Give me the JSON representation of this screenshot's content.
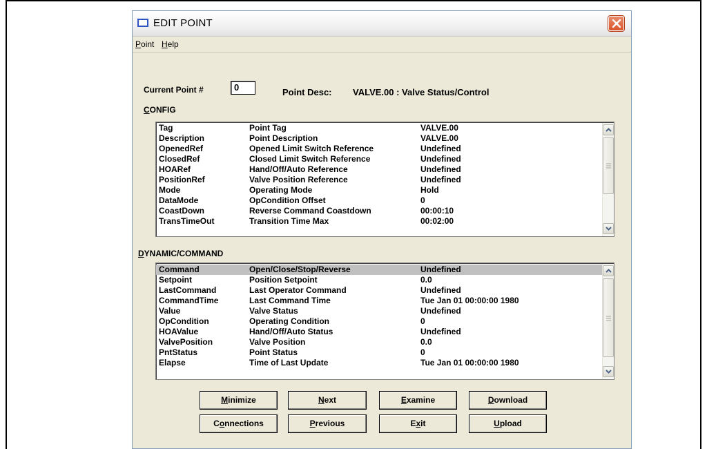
{
  "window": {
    "title": "EDIT POINT",
    "close_glyph": "×"
  },
  "menu": {
    "items": [
      {
        "mnemonic": "P",
        "rest": "oint"
      },
      {
        "mnemonic": "H",
        "rest": "elp"
      }
    ]
  },
  "current_point": {
    "label": "Current Point #",
    "value": "0"
  },
  "point_desc": {
    "label": "Point Desc:",
    "value": "VALVE.00 : Valve Status/Control"
  },
  "config": {
    "label_mnemonic": "C",
    "label_rest": "ONFIG",
    "rows": [
      {
        "name": "Tag",
        "desc": "Point Tag",
        "value": "VALVE.00"
      },
      {
        "name": "Description",
        "desc": "Point Description",
        "value": "VALVE.00"
      },
      {
        "name": "OpenedRef",
        "desc": "Opened Limit Switch Reference",
        "value": "Undefined"
      },
      {
        "name": "ClosedRef",
        "desc": "Closed Limit Switch Reference",
        "value": "Undefined"
      },
      {
        "name": "HOARef",
        "desc": "Hand/Off/Auto Reference",
        "value": "Undefined"
      },
      {
        "name": "PositionRef",
        "desc": "Valve Position Reference",
        "value": "Undefined"
      },
      {
        "name": "Mode",
        "desc": "Operating Mode",
        "value": "Hold"
      },
      {
        "name": "DataMode",
        "desc": "OpCondition Offset",
        "value": "0"
      },
      {
        "name": "CoastDown",
        "desc": "Reverse Command Coastdown",
        "value": "00:00:10"
      },
      {
        "name": "TransTimeOut",
        "desc": "Transition Time Max",
        "value": "00:02:00"
      }
    ]
  },
  "dynamic": {
    "label_mnemonic": "D",
    "label_rest": "YNAMIC/COMMAND",
    "rows": [
      {
        "name": "Command",
        "desc": "Open/Close/Stop/Reverse",
        "value": "Undefined",
        "selected": true
      },
      {
        "name": "Setpoint",
        "desc": "Position Setpoint",
        "value": "0.0"
      },
      {
        "name": "LastCommand",
        "desc": "Last Operator Command",
        "value": "Undefined"
      },
      {
        "name": "CommandTime",
        "desc": "Last Command Time",
        "value": "Tue Jan 01 00:00:00 1980"
      },
      {
        "name": "Value",
        "desc": "Valve Status",
        "value": "Undefined"
      },
      {
        "name": "OpCondition",
        "desc": "Operating Condition",
        "value": "0"
      },
      {
        "name": "HOAValue",
        "desc": "Hand/Off/Auto Status",
        "value": "Undefined"
      },
      {
        "name": "ValvePosition",
        "desc": "Valve Position",
        "value": "0.0"
      },
      {
        "name": "PntStatus",
        "desc": "Point Status",
        "value": "0"
      },
      {
        "name": "Elapse",
        "desc": "Time of Last Update",
        "value": "Tue Jan 01 00:00:00 1980"
      }
    ]
  },
  "buttons": {
    "minimize": {
      "pre": "",
      "acc": "M",
      "post": "inimize"
    },
    "next": {
      "pre": "",
      "acc": "N",
      "post": "ext"
    },
    "examine": {
      "pre": "",
      "acc": "E",
      "post": "xamine"
    },
    "download": {
      "pre": "",
      "acc": "D",
      "post": "ownload"
    },
    "connections": {
      "pre": "C",
      "acc": "o",
      "post": "nnections"
    },
    "previous": {
      "pre": "",
      "acc": "P",
      "post": "revious"
    },
    "exit": {
      "pre": "E",
      "acc": "x",
      "post": "it"
    },
    "upload": {
      "pre": "",
      "acc": "U",
      "post": "pload"
    }
  },
  "icons": {
    "title": "window-icon",
    "close": "close-icon",
    "scroll_up": "chevron-up-icon",
    "scroll_down": "chevron-down-icon",
    "grip": "scroll-grip-icon"
  },
  "colors": {
    "close_button": "#d9552b",
    "window_bg": "#ece9d8",
    "selected_row": "#c0c0c0"
  }
}
